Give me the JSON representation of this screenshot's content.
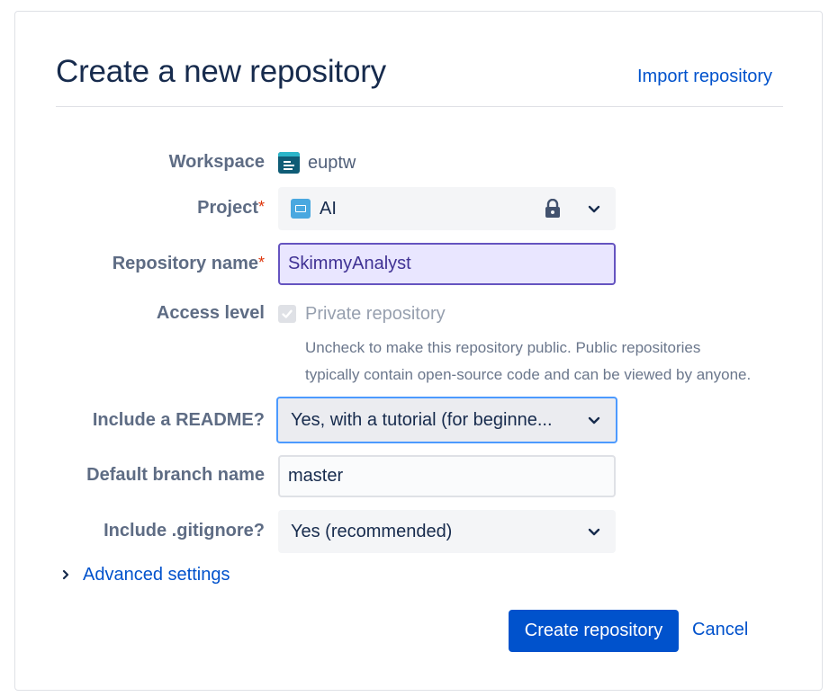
{
  "header": {
    "title": "Create a new repository",
    "import_link": "Import repository"
  },
  "form": {
    "workspace": {
      "label": "Workspace",
      "value": "euptw"
    },
    "project": {
      "label": "Project",
      "required_mark": "*",
      "value": "AI",
      "locked": true
    },
    "repository_name": {
      "label": "Repository name",
      "required_mark": "*",
      "value": "SkimmyAnalyst"
    },
    "access_level": {
      "label": "Access level",
      "checkbox_label": "Private repository",
      "checked": true,
      "help_line1": "Uncheck to make this repository public. Public repositories",
      "help_line2": "typically contain open-source code and can be viewed by anyone."
    },
    "readme": {
      "label": "Include a README?",
      "value": "Yes, with a tutorial (for beginne..."
    },
    "default_branch": {
      "label": "Default branch name",
      "value": "master"
    },
    "gitignore": {
      "label": "Include .gitignore?",
      "value": "Yes (recommended)"
    },
    "advanced_settings": "Advanced settings"
  },
  "actions": {
    "create": "Create repository",
    "cancel": "Cancel"
  },
  "colors": {
    "primary": "#0052cc",
    "required": "#de350b",
    "focus_border": "#4c9aff",
    "active_input_border": "#6554c0"
  }
}
